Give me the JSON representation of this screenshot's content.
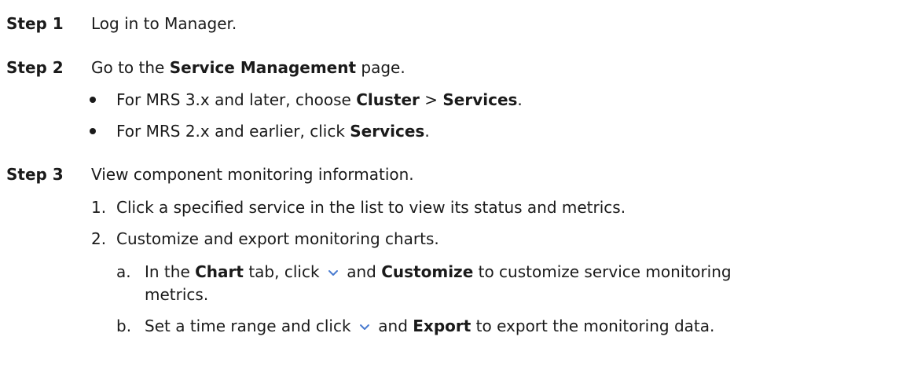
{
  "steps": [
    {
      "label": "Step 1",
      "text": "Log in to Manager."
    },
    {
      "label": "Step 2",
      "prefix": "Go to the ",
      "bold": "Service Management",
      "suffix": " page.",
      "bullets": [
        {
          "prefix": "For MRS 3.x and later, choose ",
          "bold1": "Cluster",
          "mid": " > ",
          "bold2": "Services",
          "suffix": "."
        },
        {
          "prefix": "For MRS 2.x and earlier, click ",
          "bold": "Services",
          "suffix": "."
        }
      ]
    },
    {
      "label": "Step 3",
      "text": "View component monitoring information.",
      "items": [
        {
          "num": "1.",
          "text": "Click a specified service in the list to view its status and metrics."
        },
        {
          "num": "2.",
          "text": "Customize and export monitoring charts.",
          "subitems": [
            {
              "letter": "a.",
              "prefix": "In the ",
              "bold1": "Chart",
              "mid1": " tab, click ",
              "mid2": " and ",
              "bold2": "Customize",
              "suffix": " to customize service monitoring",
              "continuation": "metrics."
            },
            {
              "letter": "b.",
              "prefix": "Set a time range and click ",
              "mid": " and ",
              "bold": "Export",
              "suffix": " to export the monitoring data."
            }
          ]
        }
      ]
    }
  ],
  "icons": {
    "dropdown": "chevron-down-icon",
    "color": "#4a7bd0"
  }
}
